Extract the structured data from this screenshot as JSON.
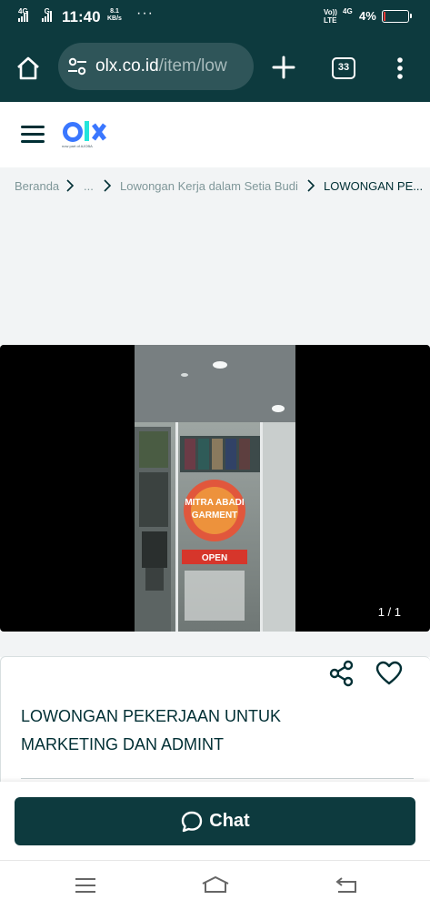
{
  "status_bar": {
    "network_1": "4G",
    "network_2": "G",
    "time": "11:40",
    "speed_value": "8.1",
    "speed_unit": "KB/s",
    "more": "···",
    "volte_top": "Vo))",
    "volte_bottom": "LTE",
    "network_3": "4G",
    "battery_percent": "4%",
    "battery_level": 0.04
  },
  "browser": {
    "url_host": "olx.co.id",
    "url_path": "/item/low",
    "tab_count": "33"
  },
  "header": {
    "logo_text": "olx",
    "logo_tagline": "now part of AJOBA"
  },
  "breadcrumb": {
    "items": [
      "Beranda",
      "...",
      "Lowongan Kerja dalam Setia Budi",
      "LOWONGAN PE..."
    ]
  },
  "gallery": {
    "counter": "1 / 1",
    "photo_signage": "MITRA ABADI GARMENT",
    "photo_open": "OPEN"
  },
  "ad": {
    "title": "LOWONGAN PEKERJAAN UNTUK MARKETING DAN ADMINT"
  },
  "actions": {
    "chat_label": "Chat"
  },
  "colors": {
    "brand_dark": "#0d3a3e",
    "pill": "#2f5559",
    "page_grey": "#f2f4f5",
    "text": "#002f34",
    "logo_blue": "#3a77ff",
    "logo_green": "#23e5db"
  }
}
